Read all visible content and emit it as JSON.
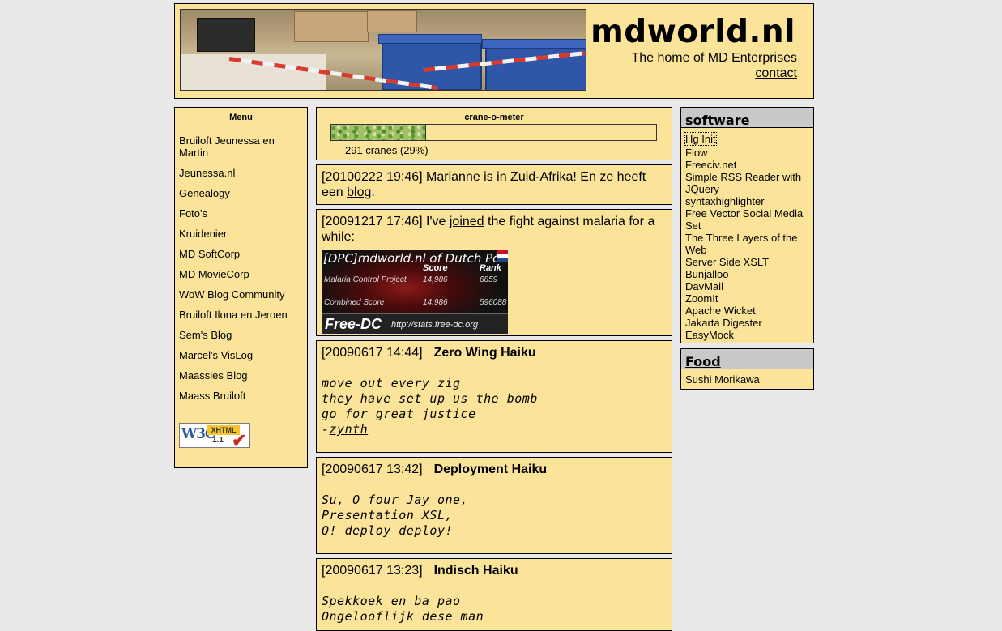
{
  "header": {
    "site_title": "mdworld.nl",
    "tagline": "The home of MD Enterprises",
    "contact_label": "contact"
  },
  "menu": {
    "title": "Menu",
    "items": [
      "Bruiloft Jeunessa en Martin",
      "Jeunessa.nl",
      "Genealogy",
      "Foto's",
      "Kruidenier",
      "MD SoftCorp",
      "MD MovieCorp",
      "WoW Blog Community",
      "Bruiloft Ilona en Jeroen",
      "Sem's Blog",
      "Marcel's VisLog",
      "Maassies Blog",
      "Maass Bruiloft"
    ],
    "badge": {
      "w3c": "W3C",
      "label": "XHTML",
      "version": "1.1"
    }
  },
  "crane": {
    "title": "crane-o-meter",
    "count_text": "291 cranes (29%)",
    "fraction": 0.29
  },
  "posts": [
    {
      "stamp": "[20100222 19:46]",
      "text_before": " Marianne is in Zuid-Afrika! En ze heeft een ",
      "link": "blog",
      "text_after": "."
    },
    {
      "stamp": "[20091217 17:46]",
      "text_before": " I've ",
      "link": "joined",
      "text_after": " the fight against malaria for a while:",
      "banner": {
        "headline": "[DPC]mdworld.nl of Dutch Pow",
        "col_score": "Score",
        "col_rank": "Rank",
        "row1_label": "Malaria Control Project",
        "row1_score": "14,986",
        "row1_rank": "6859",
        "row2_label": "Combined Score",
        "row2_score": "14,986",
        "row2_rank": "596088",
        "brand": "Free-DC",
        "url": "http://stats.free-dc.org"
      }
    },
    {
      "stamp": "[20090617 14:44]",
      "title": "Zero Wing Haiku",
      "lines": [
        "move out every zig",
        "they have set up us the bomb",
        "go for great justice"
      ],
      "sign_prefix": "-",
      "sign_link": "zynth"
    },
    {
      "stamp": "[20090617 13:42]",
      "title": "Deployment Haiku",
      "lines": [
        "Su, O four Jay one,",
        "Presentation XSL,",
        "O! deploy deploy!"
      ]
    },
    {
      "stamp": "[20090617 13:23]",
      "title": "Indisch Haiku",
      "lines": [
        "Spekkoek en ba pao",
        "Ongelooflijk dese man"
      ]
    }
  ],
  "software": {
    "heading": "software",
    "items": [
      "Hg Init",
      "Flow",
      "Freeciv.net",
      "Simple RSS Reader with JQuery",
      "syntaxhighlighter",
      "Free Vector Social Media Set",
      "The Three Layers of the Web",
      "Server Side XSLT",
      "Bunjalloo",
      "DavMail",
      "ZoomIt",
      "Apache Wicket",
      "Jakarta Digester",
      "EasyMock"
    ]
  },
  "food": {
    "heading": "Food",
    "items": [
      "Sushi Morikawa"
    ]
  }
}
